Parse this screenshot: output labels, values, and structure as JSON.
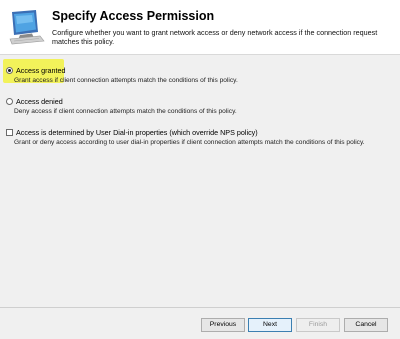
{
  "header": {
    "title": "Specify Access Permission",
    "description": "Configure whether you want to grant network access or deny network access if the connection request matches this policy."
  },
  "options": [
    {
      "type": "radio",
      "label": "Access granted",
      "description": "Grant access if client connection attempts match the conditions of this policy.",
      "checked": true,
      "highlighted": true
    },
    {
      "type": "radio",
      "label": "Access denied",
      "description": "Deny access if client connection attempts match the conditions of this policy.",
      "checked": false
    },
    {
      "type": "checkbox",
      "label": "Access is determined by User Dial-in properties (which override NPS policy)",
      "description": "Grant or deny access according to user dial-in properties if client connection attempts match the conditions of this policy.",
      "checked": false
    }
  ],
  "buttons": {
    "previous": "Previous",
    "next": "Next",
    "finish": "Finish",
    "cancel": "Cancel"
  },
  "colors": {
    "highlight": "#f2f25a",
    "header_bg": "#ffffff",
    "window_bg": "#f0f0f0"
  },
  "icons": {
    "wizard": "computer-monitor-icon"
  }
}
